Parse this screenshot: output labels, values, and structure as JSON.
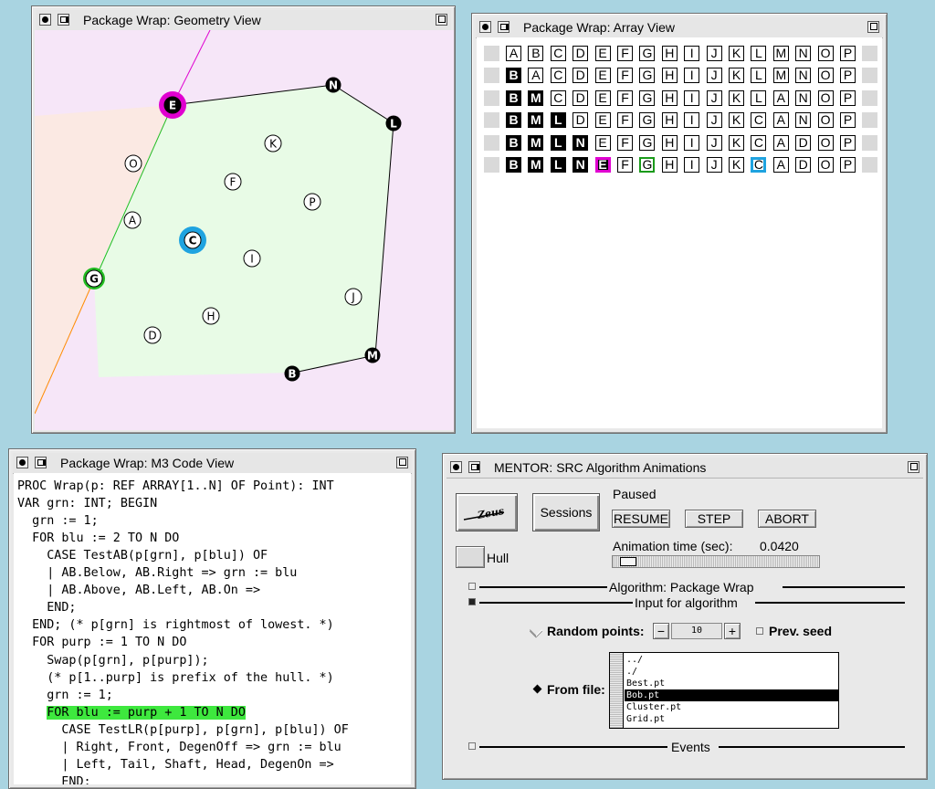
{
  "geometry_window": {
    "title": "Package Wrap: Geometry View",
    "points": [
      {
        "label": "E",
        "style": "hl-magenta"
      },
      {
        "label": "N",
        "style": "hull"
      },
      {
        "label": "L",
        "style": "hull"
      },
      {
        "label": "K",
        "style": "plain"
      },
      {
        "label": "O",
        "style": "plain"
      },
      {
        "label": "F",
        "style": "plain"
      },
      {
        "label": "P",
        "style": "plain"
      },
      {
        "label": "A",
        "style": "plain"
      },
      {
        "label": "C",
        "style": "hl-blue"
      },
      {
        "label": "I",
        "style": "plain"
      },
      {
        "label": "G",
        "style": "hl-green"
      },
      {
        "label": "J",
        "style": "plain"
      },
      {
        "label": "H",
        "style": "plain"
      },
      {
        "label": "D",
        "style": "plain"
      },
      {
        "label": "M",
        "style": "hull"
      },
      {
        "label": "B",
        "style": "hull"
      }
    ],
    "colors": {
      "hull_fill": "#e8fbe6",
      "left_region": "#fbe9e3",
      "background": "#f6e6f8",
      "magenta": "#e000d0",
      "green": "#22bb22",
      "blue": "#1fa3e0",
      "orange": "#ff8c00"
    }
  },
  "array_window": {
    "title": "Package Wrap: Array View",
    "rows": [
      [
        "A",
        "B",
        "C",
        "D",
        "E",
        "F",
        "G",
        "H",
        "I",
        "J",
        "K",
        "L",
        "M",
        "N",
        "O",
        "P"
      ],
      [
        "B",
        "A",
        "C",
        "D",
        "E",
        "F",
        "G",
        "H",
        "I",
        "J",
        "K",
        "L",
        "M",
        "N",
        "O",
        "P"
      ],
      [
        "B",
        "M",
        "C",
        "D",
        "E",
        "F",
        "G",
        "H",
        "I",
        "J",
        "K",
        "L",
        "A",
        "N",
        "O",
        "P"
      ],
      [
        "B",
        "M",
        "L",
        "D",
        "E",
        "F",
        "G",
        "H",
        "I",
        "J",
        "K",
        "C",
        "A",
        "N",
        "O",
        "P"
      ],
      [
        "B",
        "M",
        "L",
        "N",
        "E",
        "F",
        "G",
        "H",
        "I",
        "J",
        "K",
        "C",
        "A",
        "D",
        "O",
        "P"
      ],
      [
        "B",
        "M",
        "L",
        "N",
        "E",
        "F",
        "G",
        "H",
        "I",
        "J",
        "K",
        "C",
        "A",
        "D",
        "O",
        "P"
      ]
    ],
    "black_counts": [
      0,
      1,
      2,
      3,
      4,
      4
    ],
    "last_row_highlights": {
      "magenta": 4,
      "green": 6,
      "blue": 11
    }
  },
  "code_window": {
    "title": "Package Wrap: M3 Code View",
    "lines": [
      "PROC Wrap(p: REF ARRAY[1..N] OF Point): INT",
      "VAR grn: INT; BEGIN",
      "  grn := 1;",
      "  FOR blu := 2 TO N DO",
      "    CASE TestAB(p[grn], p[blu]) OF",
      "    | AB.Below, AB.Right => grn := blu",
      "    | AB.Above, AB.Left, AB.On =>",
      "    END;",
      "  END; (* p[grn] is rightmost of lowest. *)",
      "  FOR purp := 1 TO N DO",
      "    Swap(p[grn], p[purp]);",
      "    (* p[1..purp] is prefix of the hull. *)",
      "    grn := 1;",
      "    FOR blu := purp + 1 TO N DO",
      "      CASE TestLR(p[purp], p[grn], p[blu]) OF",
      "      | Right, Front, DegenOff => grn := blu",
      "      | Left, Tail, Shaft, Head, DegenOn =>",
      "      END;"
    ],
    "highlight_line": 13,
    "highlight_color": "#3ee83e"
  },
  "mentor_window": {
    "title": "MENTOR: SRC Algorithm Animations",
    "zeus_label": "Zeus",
    "sessions_label": "Sessions",
    "status": "Paused",
    "resume_label": "RESUME",
    "step_label": "STEP",
    "abort_label": "ABORT",
    "hull_label": "Hull",
    "anim_time_label": "Animation time (sec):",
    "anim_time_value": "0.0420",
    "algorithm_label": "Algorithm:  Package Wrap",
    "input_label": "Input for algorithm",
    "random_points_label": "Random points:",
    "random_points_value": "10",
    "minus_label": "−",
    "plus_label": "+",
    "prev_seed_label": "Prev. seed",
    "from_file_label": "From file:",
    "files": [
      "../",
      "./",
      "Best.pt",
      "Bob.pt",
      "Cluster.pt",
      "Grid.pt"
    ],
    "selected_file": "Bob.pt",
    "events_label": "Events"
  }
}
